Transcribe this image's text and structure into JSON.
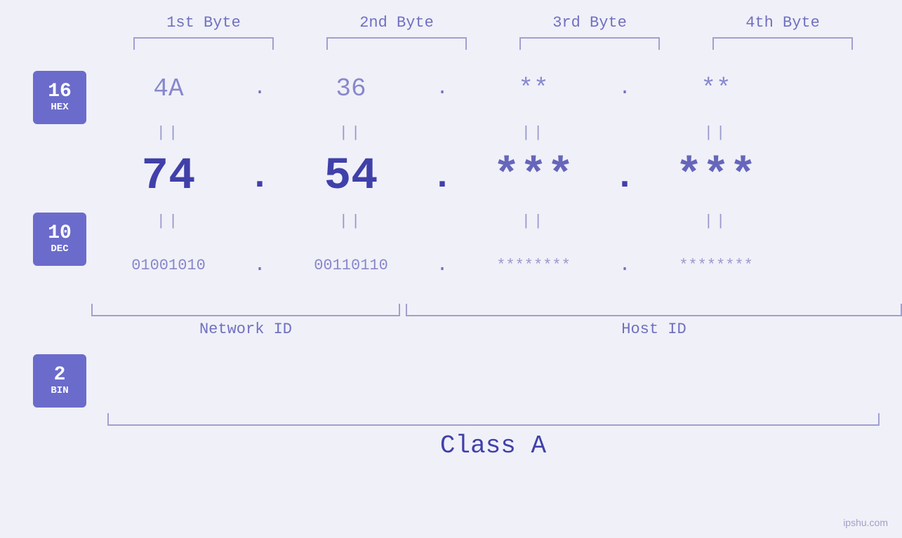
{
  "headers": {
    "byte1": "1st Byte",
    "byte2": "2nd Byte",
    "byte3": "3rd Byte",
    "byte4": "4th Byte"
  },
  "badges": [
    {
      "number": "16",
      "label": "HEX"
    },
    {
      "number": "10",
      "label": "DEC"
    },
    {
      "number": "2",
      "label": "BIN"
    }
  ],
  "hex_row": {
    "b1": "4A",
    "b2": "36",
    "b3": "**",
    "b4": "**",
    "sep": "."
  },
  "dec_row": {
    "b1": "74",
    "b2": "54",
    "b3": "***",
    "b4": "***",
    "sep": "."
  },
  "bin_row": {
    "b1": "01001010",
    "b2": "00110110",
    "b3": "********",
    "b4": "********",
    "sep": "."
  },
  "labels": {
    "network_id": "Network ID",
    "host_id": "Host ID",
    "class": "Class A"
  },
  "watermark": "ipshu.com"
}
